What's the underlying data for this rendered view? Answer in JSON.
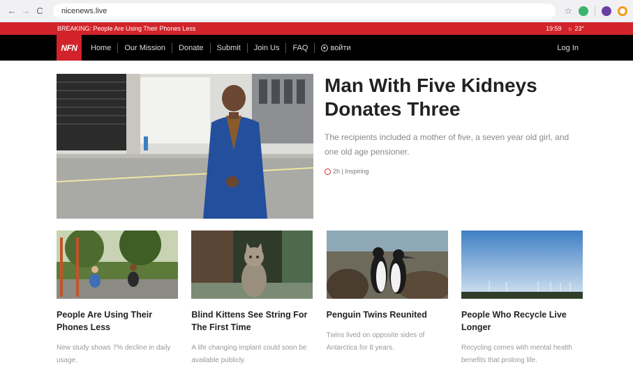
{
  "browser": {
    "url": "nicenews.live",
    "back": "←",
    "forward": "→",
    "reload": "C"
  },
  "breaking": {
    "text": "BREAKING: People Are Using Their Phones Less",
    "time": "19:59",
    "weather": "☼ 23°"
  },
  "nav": {
    "logo": "NFN",
    "items": [
      "Home",
      "Our Mission",
      "Donate",
      "Submit",
      "Join Us",
      "FAQ"
    ],
    "login_label": "войти",
    "login_right": "Log In"
  },
  "hero": {
    "title": "Man With Five Kidneys Donates Three",
    "subtitle": "The recipients included a mother of five, a seven year old girl, and one old age pensioner.",
    "meta": "2h | Inspiring"
  },
  "cards": [
    {
      "title": "People Are Using Their Phones Less",
      "desc": "New study shows 7% decline in daily usage."
    },
    {
      "title": "Blind Kittens See String For The First Time",
      "desc": "A life changing implant could soon be available publicly."
    },
    {
      "title": "Penguin Twins Reunited",
      "desc": "Twins lived on opposite sides of Antarctica for 8 years."
    },
    {
      "title": "People Who Recycle Live Longer",
      "desc": "Recycling comes with mental health benefits that prolong life."
    }
  ],
  "colors": {
    "brand_red": "#d2232a",
    "nav_black": "#000000"
  }
}
